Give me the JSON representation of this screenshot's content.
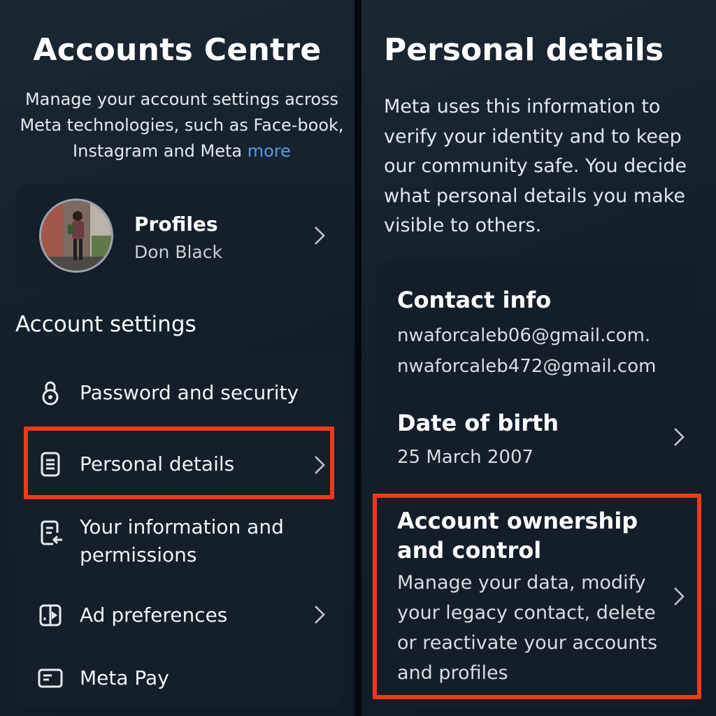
{
  "left": {
    "title": "Accounts Centre",
    "description": "Manage your account settings across Meta technologies, such as Face-book, Instagram and Meta",
    "more_link": "more",
    "profiles": {
      "label": "Profiles",
      "name": "Don Black"
    },
    "section_title": "Account settings",
    "settings": [
      {
        "label": "Password and security",
        "icon": "lock-icon"
      },
      {
        "label": "Personal details",
        "icon": "id-card-icon"
      },
      {
        "label": "Your information and permissions",
        "icon": "document-arrow-icon"
      },
      {
        "label": "Ad preferences",
        "icon": "ad-preferences-icon"
      },
      {
        "label": "Meta Pay",
        "icon": "payment-card-icon"
      }
    ]
  },
  "right": {
    "title": "Personal details",
    "description": "Meta uses this information to verify your identity and to keep our community safe. You decide what personal details you make visible to others.",
    "contact_info": {
      "heading": "Contact info",
      "emails": [
        "nwaforcaleb06@gmail.com.",
        "nwaforcaleb472@gmail.com"
      ]
    },
    "date_of_birth": {
      "heading": "Date of birth",
      "value": "25 March 2007"
    },
    "ownership": {
      "heading": "Account ownership and control",
      "description": "Manage your data, modify your legacy contact, delete or reactivate your accounts and profiles"
    }
  },
  "colors": {
    "highlight": "#f0391b",
    "link": "#5a9be8",
    "card": "#151f2a"
  }
}
